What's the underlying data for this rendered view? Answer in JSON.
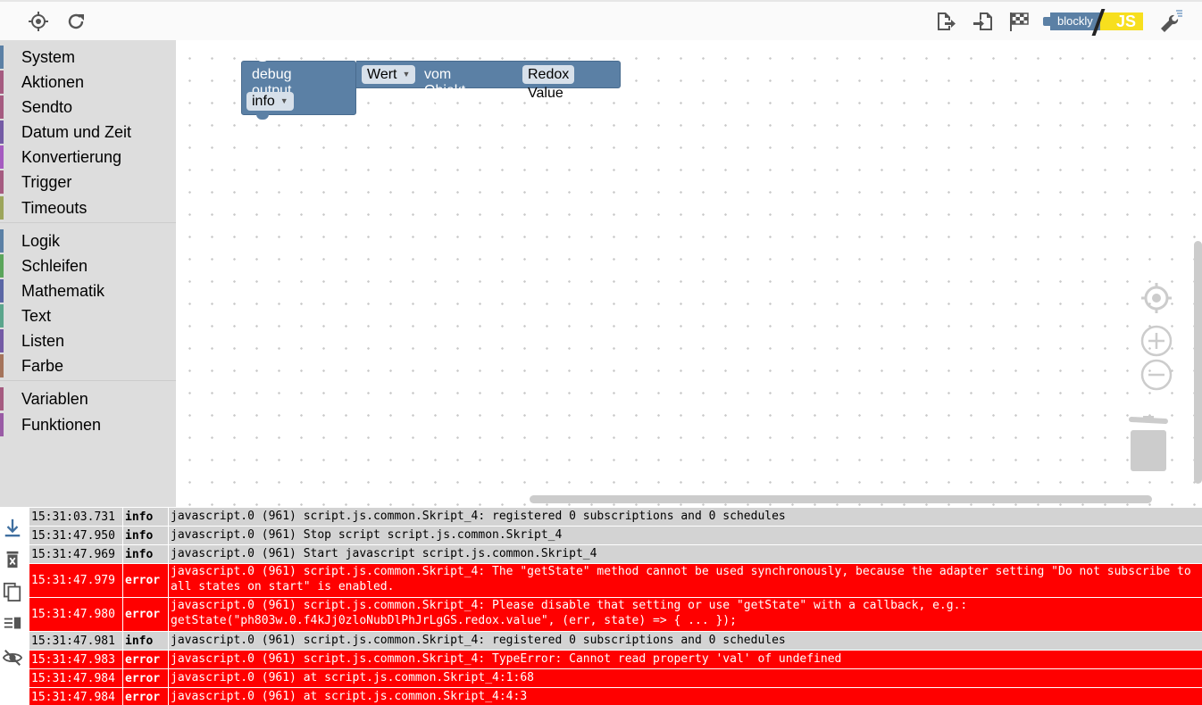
{
  "toolbar": {
    "left_icons": [
      "crosshair-icon",
      "refresh-icon"
    ],
    "right_icons": [
      "export-icon",
      "import-icon",
      "checkered-flag-icon",
      "blockly-js-logo",
      "wrench-icon"
    ],
    "logo_text_left": "blockly",
    "logo_text_right": "JS"
  },
  "toolbox": {
    "categories": [
      {
        "label": "System",
        "color": "#5b80a5"
      },
      {
        "label": "Aktionen",
        "color": "#a55b80"
      },
      {
        "label": "Sendto",
        "color": "#a55b80"
      },
      {
        "label": "Datum und Zeit",
        "color": "#745ba5"
      },
      {
        "label": "Konvertierung",
        "color": "#a55bc0"
      },
      {
        "label": "Trigger",
        "color": "#a55b80"
      },
      {
        "label": "Timeouts",
        "color": "#9ca55b"
      },
      {
        "label": "Logik",
        "color": "#5b80a5"
      },
      {
        "label": "Schleifen",
        "color": "#5ba55b"
      },
      {
        "label": "Mathematik",
        "color": "#5b67a5"
      },
      {
        "label": "Text",
        "color": "#5ba58c"
      },
      {
        "label": "Listen",
        "color": "#745ba5"
      },
      {
        "label": "Farbe",
        "color": "#a5745b"
      },
      {
        "label": "Variablen",
        "color": "#a55b80"
      },
      {
        "label": "Funktionen",
        "color": "#995ba5"
      }
    ]
  },
  "block": {
    "title": "debug output",
    "field_wert": "Wert",
    "text_vom": "vom Objekt ID",
    "field_object": "Redox Value",
    "field_level": "info",
    "color": "#5b80a5"
  },
  "workspace_controls": [
    "center-icon",
    "zoom-in-icon",
    "zoom-out-icon",
    "trash-icon"
  ],
  "log": {
    "side_icons": [
      "scroll-down-icon",
      "clear-log-icon",
      "copy-icon",
      "columns-icon",
      "hide-icon"
    ],
    "rows": [
      {
        "time": "15:31:03.731",
        "severity": "info",
        "message": "javascript.0 (961) script.js.common.Skript_4: registered 0 subscriptions and 0 schedules"
      },
      {
        "time": "15:31:47.950",
        "severity": "info",
        "message": "javascript.0 (961) Stop script script.js.common.Skript_4"
      },
      {
        "time": "15:31:47.969",
        "severity": "info",
        "message": "javascript.0 (961) Start javascript script.js.common.Skript_4"
      },
      {
        "time": "15:31:47.979",
        "severity": "error",
        "message": "javascript.0 (961) script.js.common.Skript_4: The \"getState\" method cannot be used synchronously, because the adapter setting \"Do not subscribe to all states on start\" is enabled."
      },
      {
        "time": "15:31:47.980",
        "severity": "error",
        "message": "javascript.0 (961) script.js.common.Skript_4: Please disable that setting or use \"getState\" with a callback, e.g.: getState(\"ph803w.0.f4kJj0zloNubDlPhJrLgGS.redox.value\", (err, state) => { ... });"
      },
      {
        "time": "15:31:47.981",
        "severity": "info",
        "message": "javascript.0 (961) script.js.common.Skript_4: registered 0 subscriptions and 0 schedules"
      },
      {
        "time": "15:31:47.983",
        "severity": "error",
        "message": "javascript.0 (961) script.js.common.Skript_4: TypeError: Cannot read property 'val' of undefined"
      },
      {
        "time": "15:31:47.984",
        "severity": "error",
        "message": "javascript.0 (961) at script.js.common.Skript_4:1:68"
      },
      {
        "time": "15:31:47.984",
        "severity": "error",
        "message": "javascript.0 (961) at script.js.common.Skript_4:4:3"
      }
    ]
  }
}
